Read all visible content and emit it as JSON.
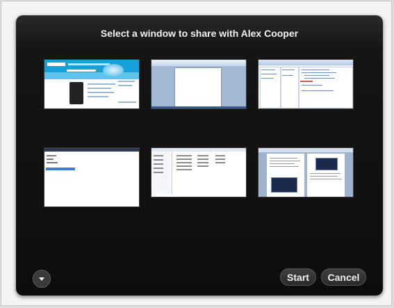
{
  "dialog": {
    "title": "Select a window to share with Alex Cooper",
    "start_label": "Start",
    "cancel_label": "Cancel",
    "menu_icon": "chevron-down-icon"
  },
  "windows": [
    {
      "kind": "web-browser"
    },
    {
      "kind": "word-document"
    },
    {
      "kind": "code-editor"
    },
    {
      "kind": "blank-document"
    },
    {
      "kind": "file-explorer"
    },
    {
      "kind": "two-page-document"
    }
  ],
  "colors": {
    "dialog_background": "#111111",
    "text": "#f2f2f2",
    "button_background": "#333333"
  }
}
